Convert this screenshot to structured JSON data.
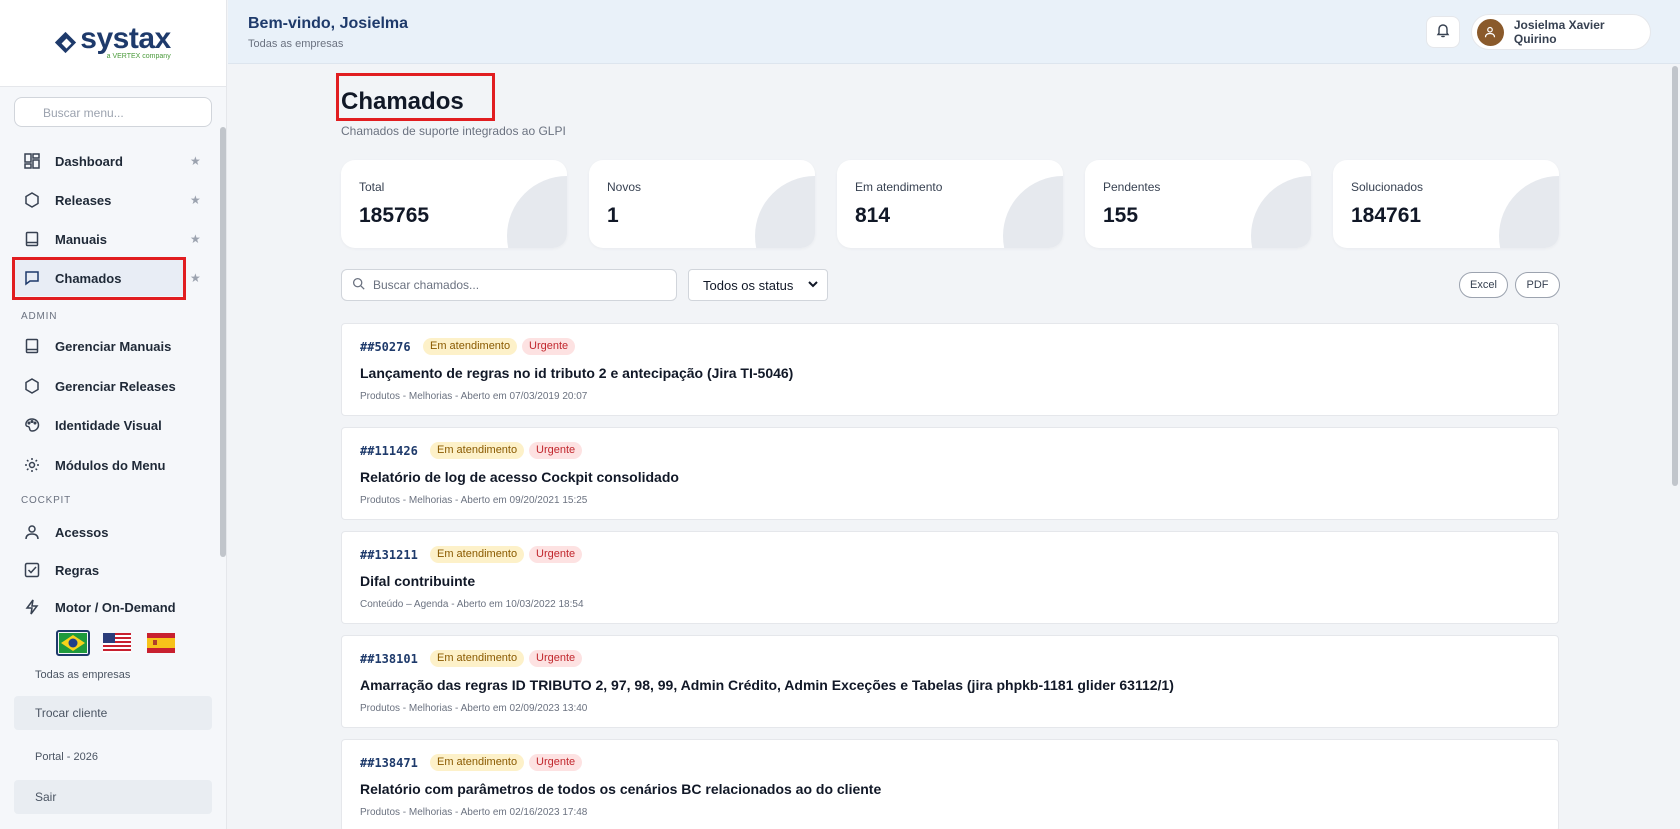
{
  "sidebar": {
    "logo": {
      "name": "systax",
      "sub": "a VERTEX company"
    },
    "search_placeholder": "Buscar menu...",
    "items": [
      {
        "label": "Dashboard",
        "icon": "dashboard-icon"
      },
      {
        "label": "Releases",
        "icon": "hexagon-icon"
      },
      {
        "label": "Manuais",
        "icon": "book-icon"
      },
      {
        "label": "Chamados",
        "icon": "message-icon"
      }
    ],
    "admin_label": "ADMIN",
    "admin_items": [
      {
        "label": "Gerenciar Manuais",
        "icon": "book-icon"
      },
      {
        "label": "Gerenciar Releases",
        "icon": "hexagon-icon"
      },
      {
        "label": "Identidade Visual",
        "icon": "palette-icon"
      },
      {
        "label": "Módulos do Menu",
        "icon": "gear-icon"
      }
    ],
    "cockpit_label": "COCKPIT",
    "cockpit_items": [
      {
        "label": "Acessos",
        "icon": "user-icon"
      },
      {
        "label": "Regras",
        "icon": "checkbox-icon"
      },
      {
        "label": "Motor / On-Demand",
        "icon": "lightning-icon"
      }
    ],
    "company": "Todas as empresas",
    "switch_client": "Trocar cliente",
    "portal": "Portal - 2026",
    "logout": "Sair"
  },
  "header": {
    "welcome": "Bem-vindo, Josielma",
    "company": "Todas as empresas",
    "user_name": "Josielma Xavier Quirino"
  },
  "page": {
    "title": "Chamados",
    "subtitle": "Chamados de suporte integrados ao GLPI"
  },
  "stats": [
    {
      "label": "Total",
      "value": "185765"
    },
    {
      "label": "Novos",
      "value": "1"
    },
    {
      "label": "Em atendimento",
      "value": "814"
    },
    {
      "label": "Pendentes",
      "value": "155"
    },
    {
      "label": "Solucionados",
      "value": "184761"
    }
  ],
  "filters": {
    "search_placeholder": "Buscar chamados...",
    "status_selected": "Todos os status",
    "excel": "Excel",
    "pdf": "PDF"
  },
  "tickets": [
    {
      "id": "##50276",
      "status": "Em atendimento",
      "priority": "Urgente",
      "title": "Lançamento de regras no id tributo 2 e antecipação (Jira TI-5046)",
      "meta": "Produtos - Melhorias - Aberto em 07/03/2019 20:07"
    },
    {
      "id": "##111426",
      "status": "Em atendimento",
      "priority": "Urgente",
      "title": "Relatório de log de acesso Cockpit consolidado",
      "meta": "Produtos - Melhorias - Aberto em 09/20/2021 15:25"
    },
    {
      "id": "##131211",
      "status": "Em atendimento",
      "priority": "Urgente",
      "title": "Difal contribuinte",
      "meta": "Conteúdo – Agenda - Aberto em 10/03/2022 18:54"
    },
    {
      "id": "##138101",
      "status": "Em atendimento",
      "priority": "Urgente",
      "title": "Amarração das regras ID TRIBUTO 2, 97, 98, 99, Admin Crédito, Admin Exceções e Tabelas (jira phpkb-1181 glider 63112/1)",
      "meta": "Produtos - Melhorias - Aberto em 02/09/2023 13:40"
    },
    {
      "id": "##138471",
      "status": "Em atendimento",
      "priority": "Urgente",
      "title": "Relatório com parâmetros de todos os cenários BC relacionados ao do cliente",
      "meta": "Produtos - Melhorias - Aberto em 02/16/2023 17:48"
    }
  ],
  "colors": {
    "accent": "#1e3a6b",
    "highlight": "#e11d20",
    "badge_status": "#fdf1c9",
    "badge_priority": "#fde2e2"
  }
}
